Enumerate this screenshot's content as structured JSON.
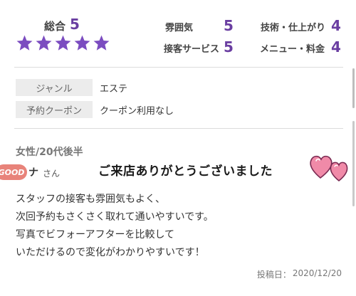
{
  "ratings": {
    "overall_label": "総合",
    "overall_value": "5",
    "star_count": 5,
    "star_color": "#7b4cc0",
    "sub": [
      {
        "label": "雰囲気",
        "value": "5"
      },
      {
        "label": "技術・仕上がり",
        "value": "4"
      },
      {
        "label": "接客サービス",
        "value": "5"
      },
      {
        "label": "メニュー・料金",
        "value": "4"
      }
    ]
  },
  "info": {
    "genre_label": "ジャンル",
    "genre_value": "エステ",
    "coupon_label": "予約クーポン",
    "coupon_value": "クーポン利用なし"
  },
  "review": {
    "reviewer": "女性/20代後半",
    "badge": "GOOD",
    "name": "ナ",
    "name_suffix": "さん",
    "overlay_text": "ご来店ありがとうございました",
    "lines": [
      "スタッフの接客も雰囲気もよく、",
      "次回予約もさくさく取れて通いやすいです。",
      "写真でビフォーアフターを比較して",
      "いただけるので変化がわかりやすいです！"
    ],
    "posted_label": "投稿日：",
    "posted_date": "2020/12/20"
  },
  "colors": {
    "accent": "#6a3ea1",
    "heart": "#f08aa8"
  }
}
